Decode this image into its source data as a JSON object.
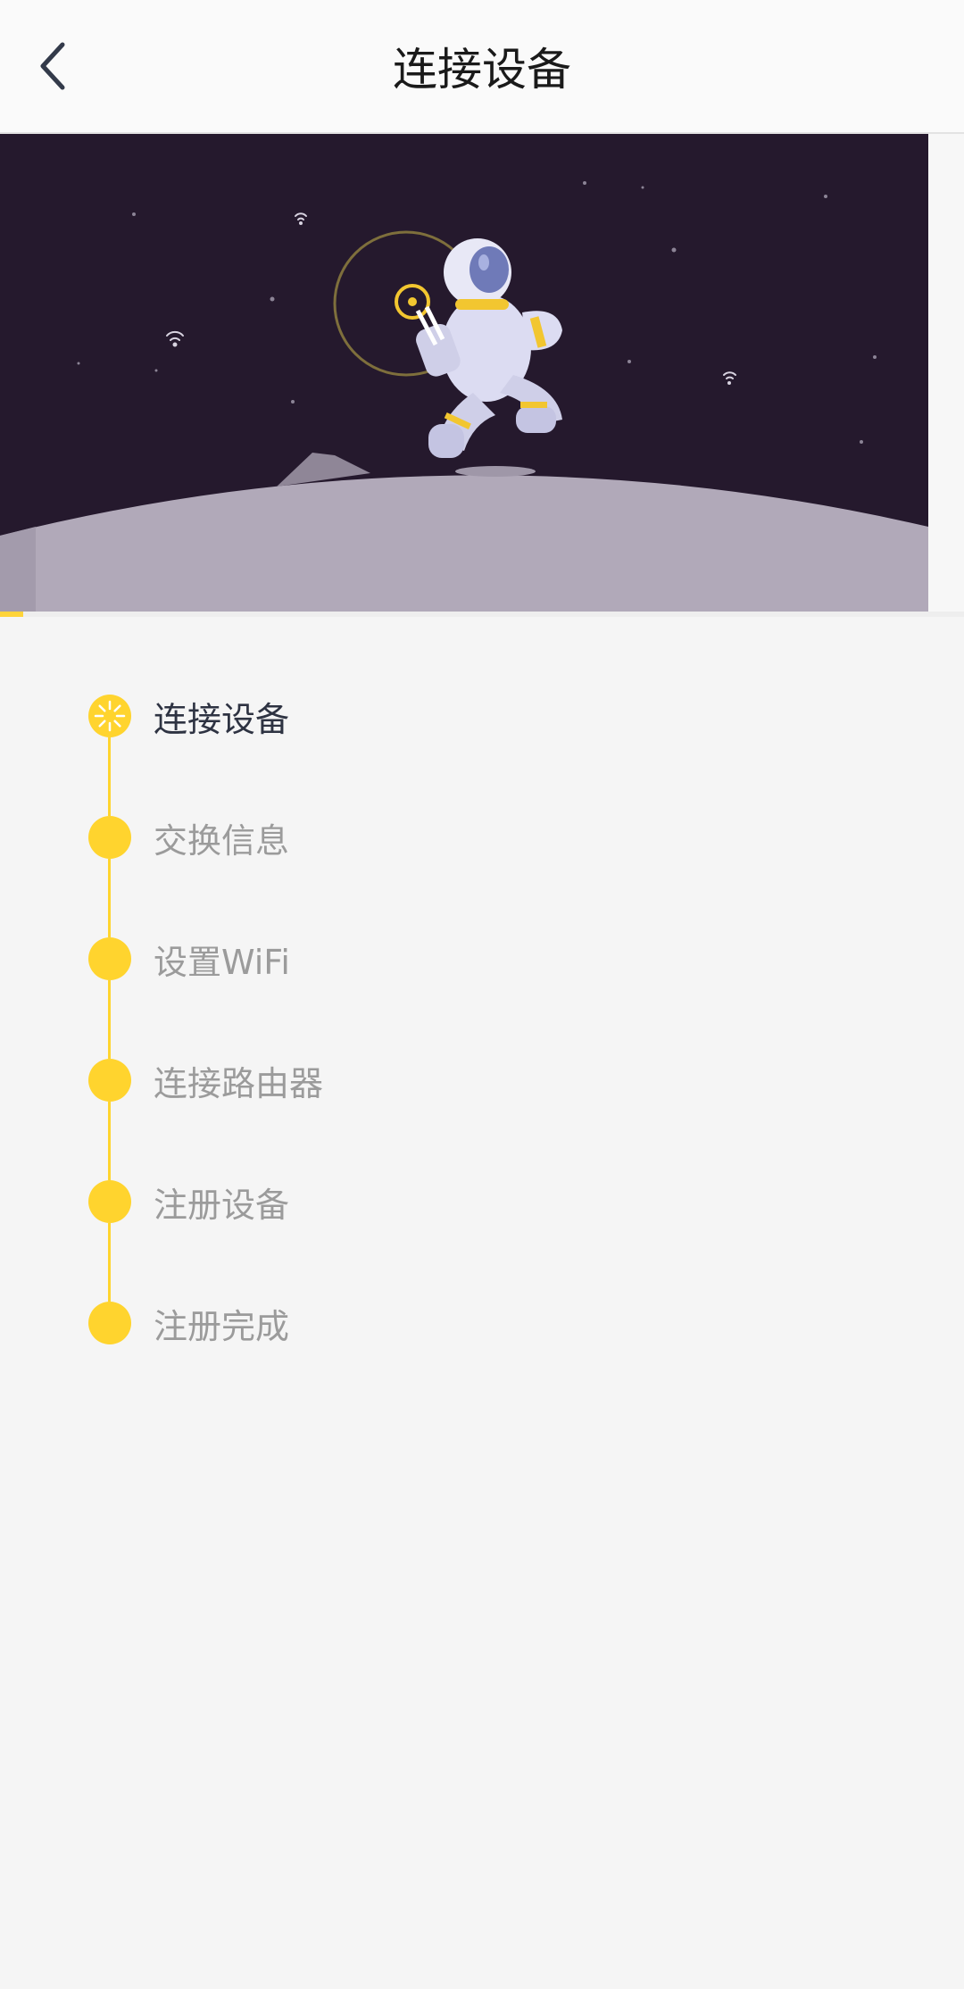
{
  "header": {
    "title": "连接设备"
  },
  "progress": {
    "value_percent": 2.4
  },
  "steps": [
    {
      "label": "连接设备",
      "state": "active"
    },
    {
      "label": "交换信息",
      "state": "pending"
    },
    {
      "label": "设置WiFi",
      "state": "pending"
    },
    {
      "label": "连接路由器",
      "state": "pending"
    },
    {
      "label": "注册设备",
      "state": "pending"
    },
    {
      "label": "注册完成",
      "state": "pending"
    }
  ],
  "colors": {
    "accent": "#ffd42e",
    "space_bg": "#25192d",
    "moon": "#b0a8b8",
    "active_text": "#2e3342",
    "inactive_text": "#9b9b9b"
  },
  "icons": {
    "back": "chevron-left-icon",
    "loading": "spinner-icon"
  }
}
